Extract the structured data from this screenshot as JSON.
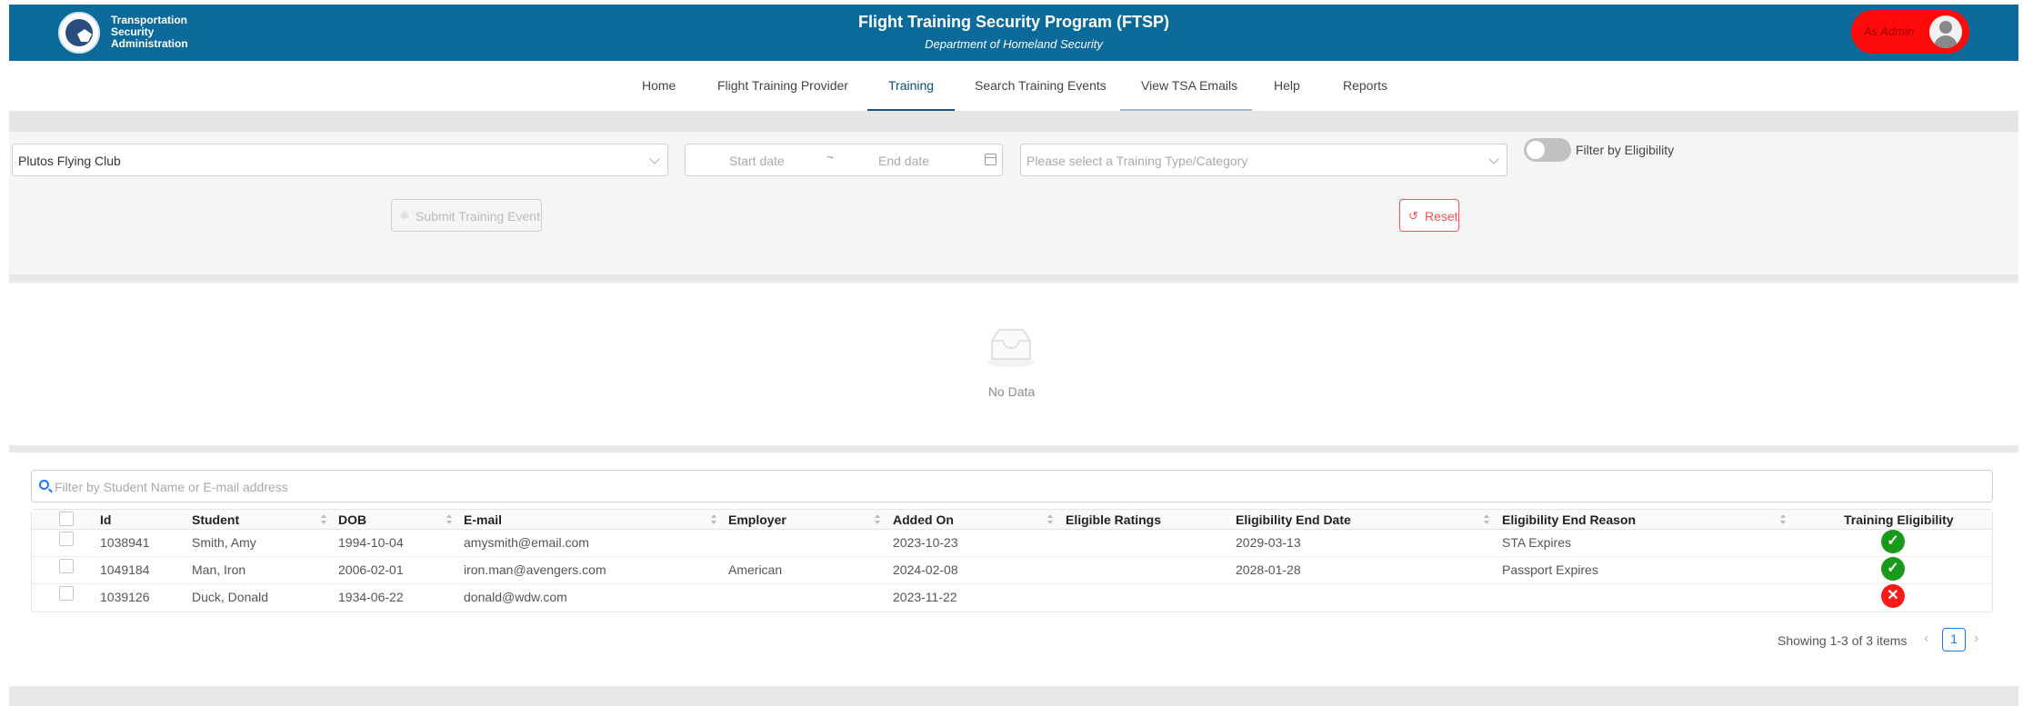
{
  "header": {
    "agency_lines": [
      "Transportation",
      "Security",
      "Administration"
    ],
    "title": "Flight Training Security Program (FTSP)",
    "subtitle": "Department of Homeland Security",
    "user_role": "As Admin",
    "accent_color": "#0b6a99"
  },
  "nav": {
    "items": [
      "Home",
      "Flight Training Provider",
      "Training",
      "Search Training Events",
      "View TSA Emails",
      "Help",
      "Reports"
    ],
    "active": "Training"
  },
  "filters": {
    "provider_value": "Plutos Flying Club",
    "start_date_placeholder": "Start date",
    "date_separator": "~",
    "end_date_placeholder": "End date",
    "training_type_placeholder": "Please select a Training Type/Category",
    "eligibility_toggle_label": "Filter by Eligibility",
    "eligibility_toggle_on": false,
    "submit_label": "Submit Training Event",
    "reset_label": "Reset"
  },
  "events": {
    "empty_text": "No Data"
  },
  "students": {
    "search_placeholder": "Filter by Student Name or E-mail address",
    "columns": [
      "Id",
      "Student",
      "DOB",
      "E-mail",
      "Employer",
      "Added On",
      "Eligible Ratings",
      "Eligibility End Date",
      "Eligibility End Reason",
      "Training Eligibility"
    ],
    "rows": [
      {
        "id": "1038941",
        "student": "Smith, Amy",
        "dob": "1994-10-04",
        "email": "amysmith@email.com",
        "employer": "",
        "added_on": "2023-10-23",
        "eligible_ratings": "",
        "end_date": "2029-03-13",
        "end_reason": "STA Expires",
        "eligible": "yes"
      },
      {
        "id": "1049184",
        "student": "Man, Iron",
        "dob": "2006-02-01",
        "email": "iron.man@avengers.com",
        "employer": "American",
        "added_on": "2024-02-08",
        "eligible_ratings": "",
        "end_date": "2028-01-28",
        "end_reason": "Passport Expires",
        "eligible": "yes"
      },
      {
        "id": "1039126",
        "student": "Duck, Donald",
        "dob": "1934-06-22",
        "email": "donald@wdw.com",
        "employer": "",
        "added_on": "2023-11-22",
        "eligible_ratings": "",
        "end_date": "",
        "end_reason": "",
        "eligible": "no"
      }
    ],
    "status_colors": {
      "eligible": "#1a9a1a",
      "ineligible": "#ff1a1a"
    }
  },
  "pagination": {
    "summary": "Showing 1-3 of 3 items",
    "current_page": "1"
  }
}
